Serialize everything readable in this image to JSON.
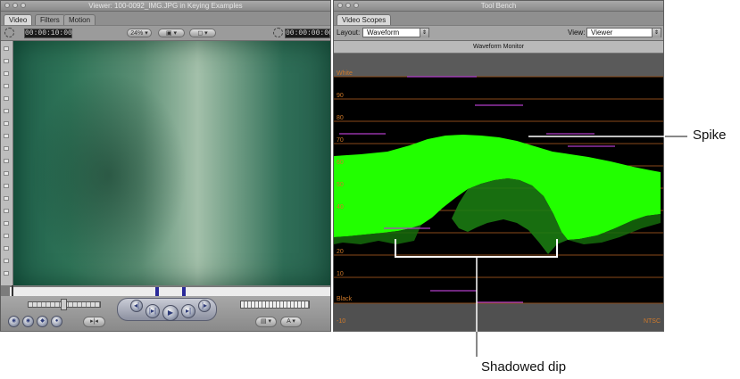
{
  "viewer": {
    "title": "Viewer: 100-0092_IMG.JPG in Keying Examples",
    "tabs": [
      "Video",
      "Filters",
      "Motion"
    ],
    "timecode_left": "00:00:10:00",
    "zoom": "24%",
    "timecode_right": "00:00:00:00"
  },
  "toolbench": {
    "title": "Tool Bench",
    "tab": "Video Scopes",
    "layout_label": "Layout:",
    "layout_value": "Waveform",
    "view_label": "View:",
    "view_value": "Viewer",
    "monitor_title": "Waveform Monitor",
    "scale": {
      "white": "White",
      "l90": "90",
      "l80": "80",
      "l70": "70",
      "l60": "60",
      "l50": "50",
      "l40": "40",
      "l20": "20",
      "l10": "10",
      "black": "Black",
      "neg10": "-10",
      "standard": "NTSC"
    }
  },
  "annotations": {
    "spike": "Spike",
    "shadowed_dip": "Shadowed dip"
  },
  "colors": {
    "waveform_green": "#22ff00",
    "scale_orange": "#d07a2a",
    "spike_magenta": "#b03cc8"
  }
}
